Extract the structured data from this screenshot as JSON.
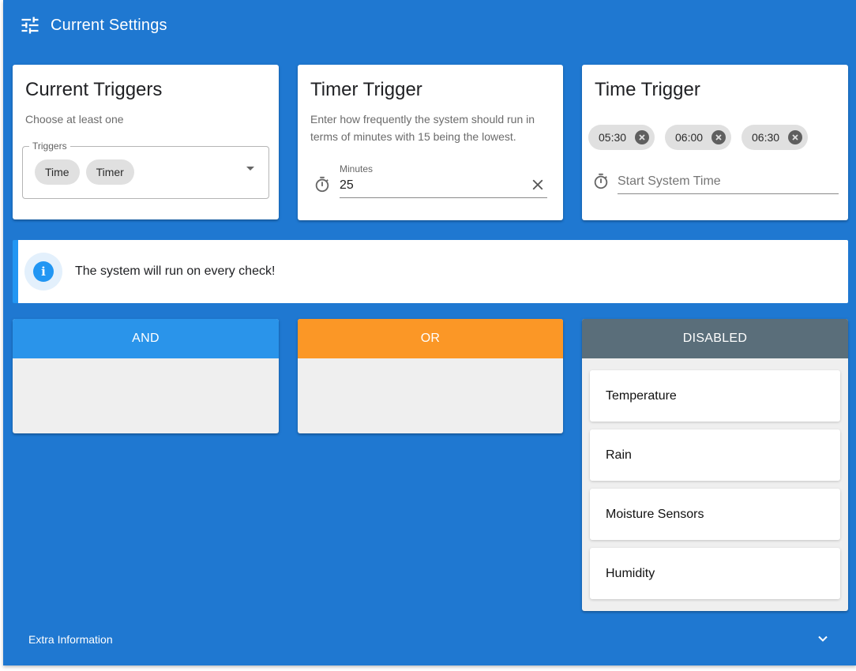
{
  "header": {
    "title": "Current Settings",
    "icon": "tune-icon"
  },
  "current_triggers": {
    "title": "Current Triggers",
    "subtitle": "Choose at least one",
    "select_label": "Triggers",
    "chips": [
      "Time",
      "Timer"
    ]
  },
  "timer_trigger": {
    "title": "Timer Trigger",
    "description": "Enter how frequently the system should run in terms of minutes with 15 being the lowest.",
    "field_label": "Minutes",
    "field_value": "25"
  },
  "time_trigger": {
    "title": "Time Trigger",
    "chips": [
      "05:30",
      "06:00",
      "06:30"
    ],
    "placeholder": "Start System Time"
  },
  "banner": {
    "text": "The system will run on every check!"
  },
  "columns": {
    "and": {
      "label": "AND",
      "color": "#2a94ea"
    },
    "or": {
      "label": "OR",
      "color": "#fb9726"
    },
    "disabled": {
      "label": "DISABLED",
      "color": "#5a6e7a",
      "items": [
        "Temperature",
        "Rain",
        "Moisture Sensors",
        "Humidity"
      ]
    }
  },
  "footer": {
    "label": "Extra Information"
  },
  "colors": {
    "background": "#1f78d1",
    "accent": "#2196f3"
  }
}
